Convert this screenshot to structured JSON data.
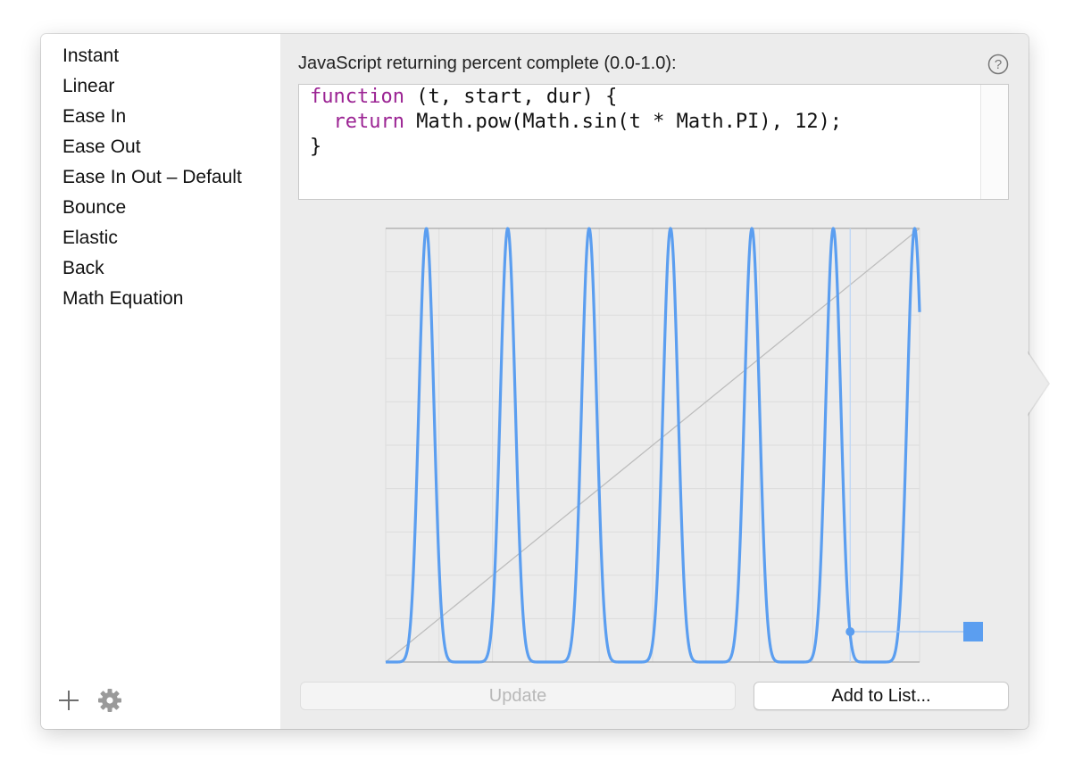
{
  "prompt": {
    "label": "JavaScript returning percent complete (0.0-1.0):",
    "help_glyph": "?"
  },
  "presets": [
    {
      "label": "Instant"
    },
    {
      "label": "Linear"
    },
    {
      "label": "Ease In"
    },
    {
      "label": "Ease Out"
    },
    {
      "label": "Ease In Out – Default"
    },
    {
      "label": "Bounce"
    },
    {
      "label": "Elastic"
    },
    {
      "label": "Back"
    },
    {
      "label": "Math Equation"
    }
  ],
  "code": {
    "line1_kw": "function",
    "line1_rest": " (t, start, dur) {",
    "line2_indent": "  ",
    "line2_kw": "return",
    "line2_rest": " Math.pow(Math.sin(t * Math.PI), 12);",
    "line3": "}"
  },
  "buttons": {
    "update": "Update",
    "add_to_list": "Add to List..."
  },
  "icons": {
    "add": "plus-icon",
    "settings": "gear-icon",
    "help": "question-mark-icon"
  },
  "colors": {
    "curve": "#5b9ef0",
    "linear_reference": "#bdbdbd",
    "keyword": "#9b2393",
    "handle": "#5b9ef0"
  },
  "chart_data": {
    "type": "line",
    "x_range": [
      0,
      1
    ],
    "y_range": [
      0,
      1
    ],
    "grid": true,
    "series": [
      {
        "expression": "Math.pow(Math.sin(t * Math.PI * 6.56), 12)",
        "color": "#5b9ef0"
      },
      {
        "expression": "t",
        "color": "#bdbdbd"
      }
    ],
    "playhead": {
      "t": 0.87,
      "value": 0.07
    }
  }
}
